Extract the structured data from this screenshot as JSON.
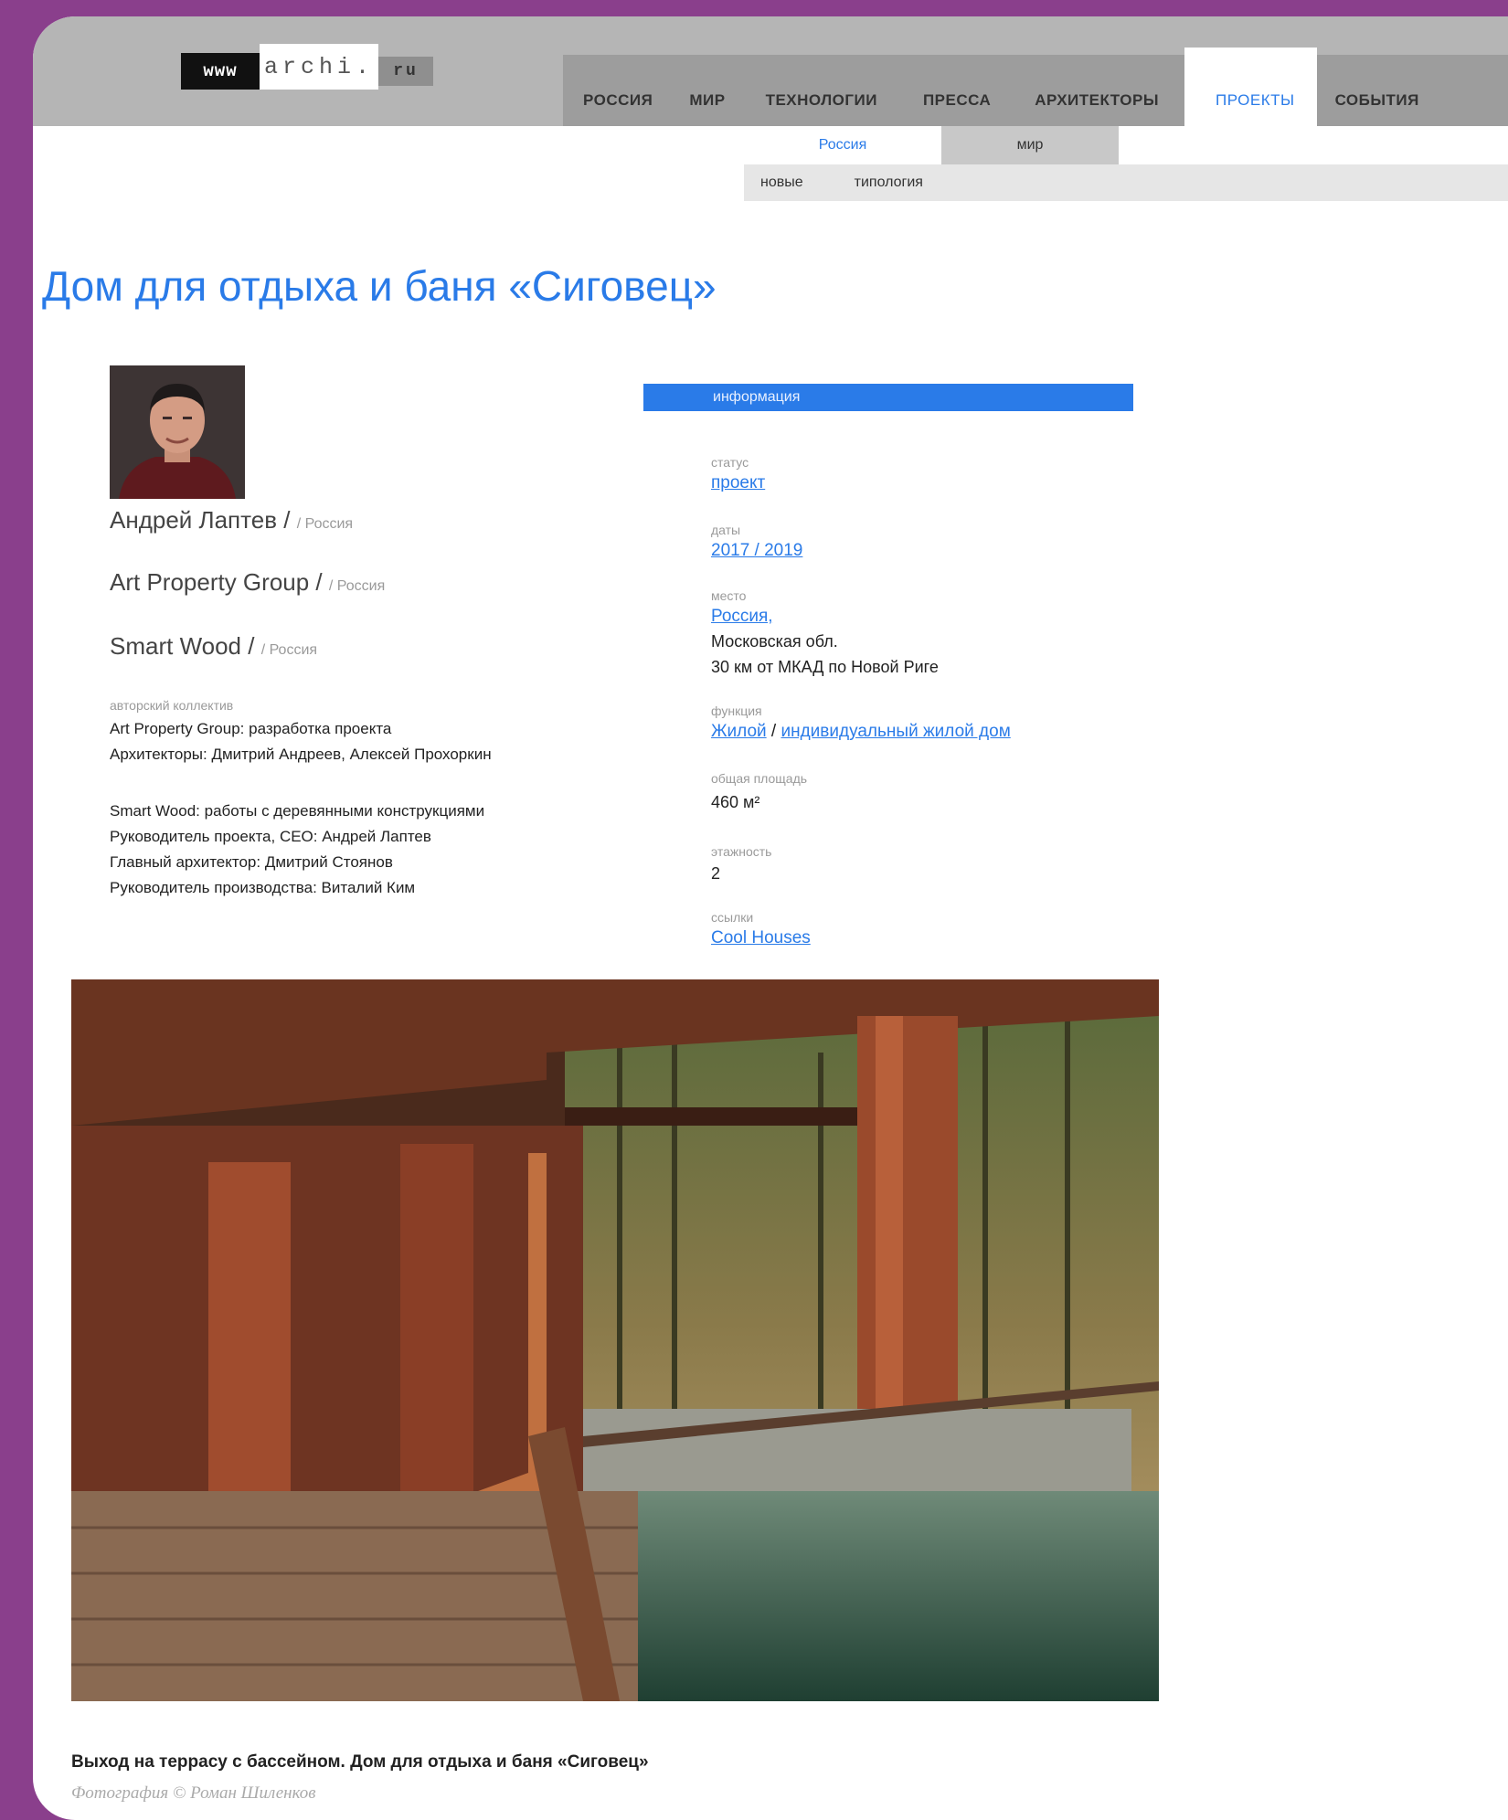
{
  "logo": {
    "www": "www",
    "archi": "archi.",
    "ru": "ru"
  },
  "nav": {
    "items": [
      "РОССИЯ",
      "МИР",
      "ТЕХНОЛОГИИ",
      "ПРЕССА",
      "АРХИТЕКТОРЫ",
      "ПРОЕКТЫ",
      "СОБЫТИЯ"
    ],
    "active": "ПРОЕКТЫ"
  },
  "subnav": {
    "russia": "Россия",
    "world": "мир",
    "new": "новые",
    "typology": "типология"
  },
  "page_title": "Дом для отдыха и баня «Сиговец»",
  "authors": [
    {
      "name": "Андрей Лаптев",
      "sep": " / ",
      "country": "/ Россия"
    },
    {
      "name": "Art Property Group",
      "sep": " / ",
      "country": "/ Россия"
    },
    {
      "name": "Smart Wood",
      "sep": " / ",
      "country": "/ Россия"
    }
  ],
  "team": {
    "label": "авторский коллектив",
    "lines1": [
      "Art Property Group: разработка проекта",
      "Архитекторы: Дмитрий Андреев, Алексей Прохоркин"
    ],
    "lines2": [
      "Smart Wood: работы с деревянными конструкциями",
      "Руководитель проекта, CEO: Андрей Лаптев",
      "Главный архитектор: Дмитрий Стоянов",
      "Руководитель производства: Виталий Ким"
    ]
  },
  "info": {
    "header": "информация",
    "status_label": "статус",
    "status_value": "проект",
    "dates_label": "даты",
    "dates_value": "2017 / 2019",
    "place_label": "место",
    "place_link": "Россия,",
    "place_line2": "Московская обл.",
    "place_line3": "30 км от МКАД по Новой Риге",
    "function_label": "функция",
    "function_link1": "Жилой",
    "function_sep": " / ",
    "function_link2": "индивидуальный жилой дом",
    "area_label": "общая площадь",
    "area_value": "460 м²",
    "floors_label": "этажность",
    "floors_value": "2",
    "links_label": "ссылки",
    "links_value": "Cool Houses"
  },
  "photo": {
    "caption": "Выход на террасу с бассейном. Дом для отдыха и баня «Сиговец»",
    "credit": "Фотография © Роман Шиленков"
  },
  "colors": {
    "accent": "#2a7be8",
    "frame_bg": "#8a3f8c"
  }
}
